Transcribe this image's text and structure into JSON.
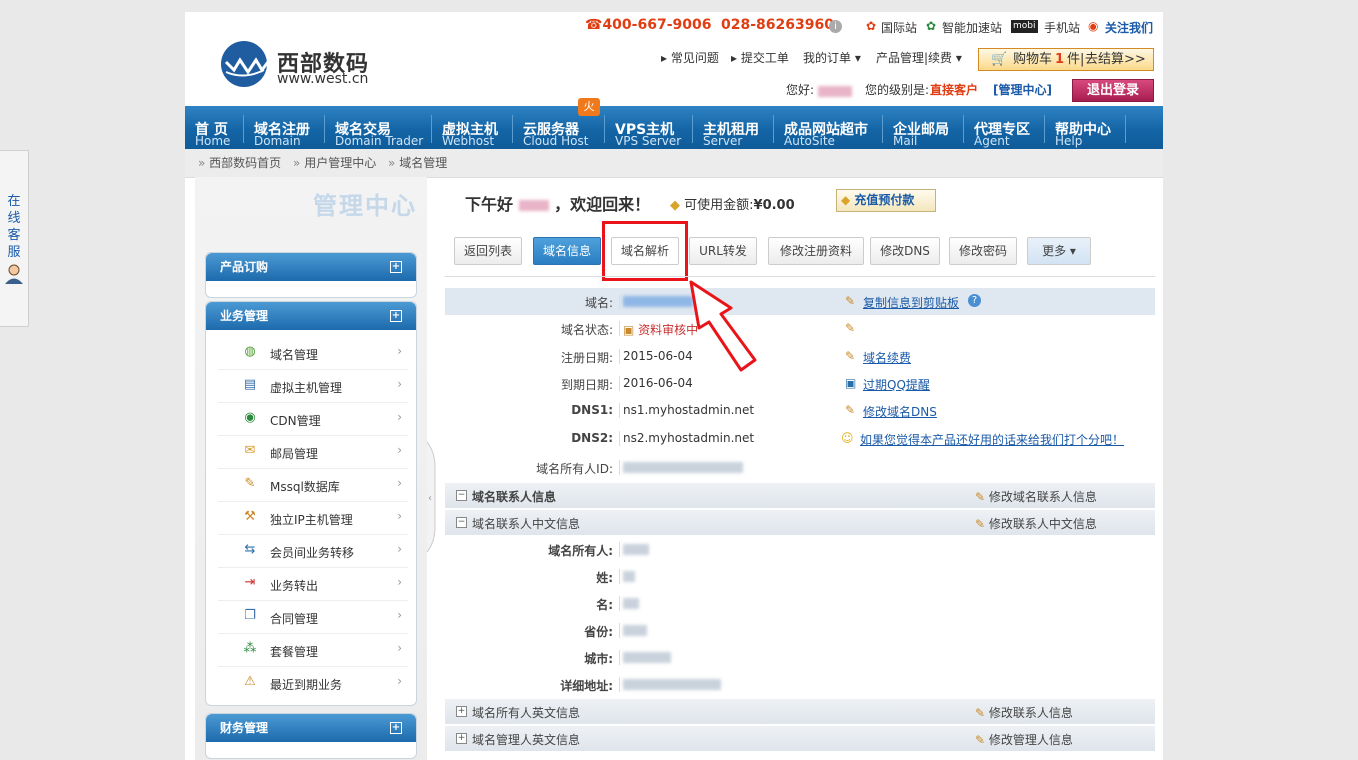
{
  "kefu": {
    "label": "在线客服"
  },
  "header": {
    "logo_cn": "西部数码",
    "logo_en": "www.west.cn",
    "phone1": "☎400-667-9006",
    "phone2": "028-86263960",
    "top_links": [
      "国际站",
      "智能加速站",
      "手机站",
      "关注我们"
    ],
    "mobi_badge": "mobi",
    "menu": [
      "常见问题",
      "提交工单",
      "我的订单",
      "产品管理|续费"
    ],
    "cart": {
      "label": "购物车",
      "count": "1",
      "unit": "件|",
      "checkout": "去结算>>"
    },
    "welcome_prefix": "您好:",
    "level_prefix": "您的级别是:",
    "level_value": "直接客户",
    "admin_link": "[管理中心]",
    "logout": "退出登录"
  },
  "nav": {
    "hot": "火",
    "items": [
      {
        "cn": "首 页",
        "en": "Home"
      },
      {
        "cn": "域名注册",
        "en": "Domain"
      },
      {
        "cn": "域名交易",
        "en": "Domain Trader"
      },
      {
        "cn": "虚拟主机",
        "en": "Webhost"
      },
      {
        "cn": "云服务器",
        "en": "Cloud Host"
      },
      {
        "cn": "VPS主机",
        "en": "VPS Server"
      },
      {
        "cn": "主机租用",
        "en": "Server"
      },
      {
        "cn": "成品网站超市",
        "en": "AutoSite"
      },
      {
        "cn": "企业邮局",
        "en": "Mail"
      },
      {
        "cn": "代理专区",
        "en": "Agent"
      },
      {
        "cn": "帮助中心",
        "en": "Help"
      }
    ]
  },
  "breadcrumb": [
    "西部数码首页",
    "用户管理中心",
    "域名管理"
  ],
  "sidebar": {
    "title": "管理中心",
    "boxes": [
      {
        "title": "产品订购"
      },
      {
        "title": "业务管理"
      },
      {
        "title": "财务管理"
      }
    ],
    "items": [
      {
        "label": "域名管理",
        "icon": "globe-icon"
      },
      {
        "label": "虚拟主机管理",
        "icon": "server-icon"
      },
      {
        "label": "CDN管理",
        "icon": "cdn-icon"
      },
      {
        "label": "邮局管理",
        "icon": "mail-icon"
      },
      {
        "label": "Mssql数据库",
        "icon": "database-icon"
      },
      {
        "label": "独立IP主机管理",
        "icon": "ip-icon"
      },
      {
        "label": "会员间业务转移",
        "icon": "transfer-icon"
      },
      {
        "label": "业务转出",
        "icon": "export-icon"
      },
      {
        "label": "合同管理",
        "icon": "contract-icon"
      },
      {
        "label": "套餐管理",
        "icon": "package-icon"
      },
      {
        "label": "最近到期业务",
        "icon": "expire-icon"
      }
    ]
  },
  "main": {
    "greeting_prefix": "下午好",
    "greeting_suffix": "，欢迎回来！",
    "balance_label": "可使用金额:",
    "balance_value": "¥0.00",
    "recharge": "充值预付款",
    "tabs": [
      "返回列表",
      "域名信息",
      "域名解析",
      "URL转发",
      "修改注册资料",
      "修改DNS",
      "修改密码",
      "更多"
    ],
    "rows": {
      "domain_label": "域名:",
      "copy_link": "复制信息到剪贴板",
      "status_label": "域名状态:",
      "status_value": "资料审核中",
      "reg_label": "注册日期:",
      "reg_value": "2015-06-04",
      "renew_link": "域名续费",
      "exp_label": "到期日期:",
      "exp_value": "2016-06-04",
      "qq_link": "过期QQ提醒",
      "dns1_label": "DNS1:",
      "dns1_value": "ns1.myhostadmin.net",
      "dns_link": "修改域名DNS",
      "dns2_label": "DNS2:",
      "dns2_value": "ns2.myhostadmin.net",
      "rate_link": "如果您觉得本产品还好用的话来给我们打个分吧！",
      "owner_id_label": "域名所有人ID:"
    },
    "sections": {
      "contact": "域名联系人信息",
      "contact_edit": "修改域名联系人信息",
      "cn_info": "域名联系人中文信息",
      "cn_edit": "修改联系人中文信息",
      "owner_en": "域名所有人英文信息",
      "owner_en_edit": "修改联系人信息",
      "admin_en": "域名管理人英文信息",
      "admin_en_edit": "修改管理人信息"
    },
    "cn_rows": [
      "域名所有人:",
      "姓:",
      "名:",
      "省份:",
      "城市:",
      "详细地址:"
    ]
  }
}
